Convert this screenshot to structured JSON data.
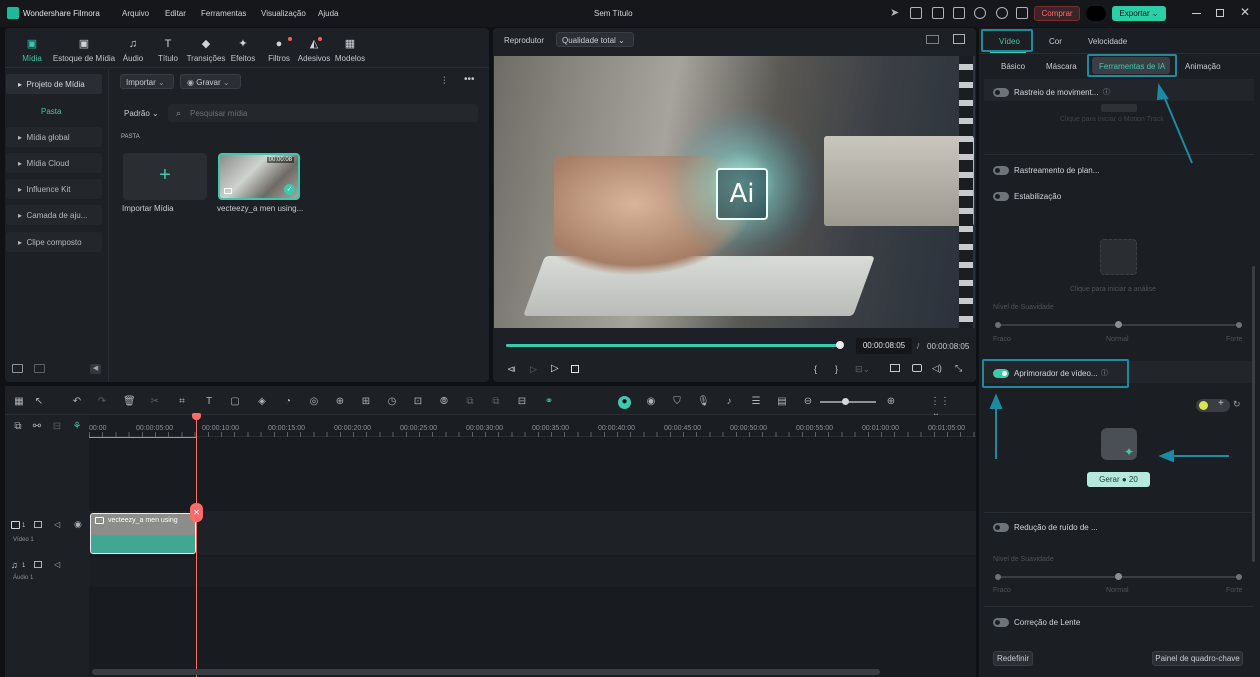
{
  "app": {
    "title": "Wondershare Filmora",
    "doc_title": "Sem Título",
    "menu": [
      "Arquivo",
      "Editar",
      "Ferramentas",
      "Visualização",
      "Ajuda"
    ],
    "buy": "Comprar",
    "export": "Exportar"
  },
  "library": {
    "tabs": [
      "Mídia",
      "Estoque de Mídia",
      "Áudio",
      "Título",
      "Transições",
      "Efeitos",
      "Filtros",
      "Adesivos",
      "Modelos"
    ],
    "sidebar": [
      "Projeto de Mídia",
      "Pasta",
      "Mídia global",
      "Mídia Cloud",
      "Influence Kit",
      "Camada de aju...",
      "Clipe composto"
    ],
    "import": "Importar",
    "record": "Gravar",
    "sort": "Padrão",
    "search_placeholder": "Pesquisar mídia",
    "folder": "PASTA",
    "import_media": "Importar Mídia",
    "clip_name": "vecteezy_a men using...",
    "clip_duration": "00:00:08"
  },
  "player": {
    "label": "Reprodutor",
    "quality": "Qualidade total",
    "current": "00:00:08:05",
    "sep": "/",
    "total": "00:00:08:05",
    "ai_text": "Ai",
    "progress": 1.0
  },
  "timeline": {
    "ruler": [
      "00:00",
      "00:00:05:00",
      "00:00:10:00",
      "00:00:15:00",
      "00:00:20:00",
      "00:00:25:00",
      "00:00:30:00",
      "00:00:35:00",
      "00:00:40:00",
      "00:00:45:00",
      "00:00:50:00",
      "00:00:55:00",
      "00:01:00:00",
      "00:01:05:00"
    ],
    "video_track": "Vídeo 1",
    "video_num": "1",
    "audio_track": "Áudio 1",
    "audio_num": "1",
    "clip_label": "vecteezy_a men using"
  },
  "inspector": {
    "tabs": [
      "Vídeo",
      "Cor",
      "Velocidade"
    ],
    "subtabs": [
      "Básico",
      "Máscara",
      "Ferramentas de IA",
      "Animação"
    ],
    "motion_tracking": "Rastreio de moviment...",
    "motion_hint": "Clique para iniciar o Motion Track",
    "plane_tracking": "Rastreamento de plan...",
    "stabilization": "Estabilização",
    "analysis_hint": "Clique para iniciar a análise",
    "smoothness": "Nível de Suavidade",
    "weak": "Fraco",
    "normal": "Normal",
    "strong": "Forte",
    "enhancer": "Aprimorador de vídeo...",
    "generate": "Gerar",
    "credits": "20",
    "noise": "Redução de ruído de ...",
    "smoothness2": "Nível de Suavidade",
    "weak2": "Fraco",
    "normal2": "Normal",
    "strong2": "Forte",
    "lens": "Correção de Lente",
    "reset": "Redefinir",
    "keyframe": "Painel de quadro-chave"
  },
  "colors": {
    "accent": "#3ec8ad",
    "highlight": "#1a8ba3",
    "playhead": "#ff6b6b",
    "buy": "#d94a4a"
  }
}
